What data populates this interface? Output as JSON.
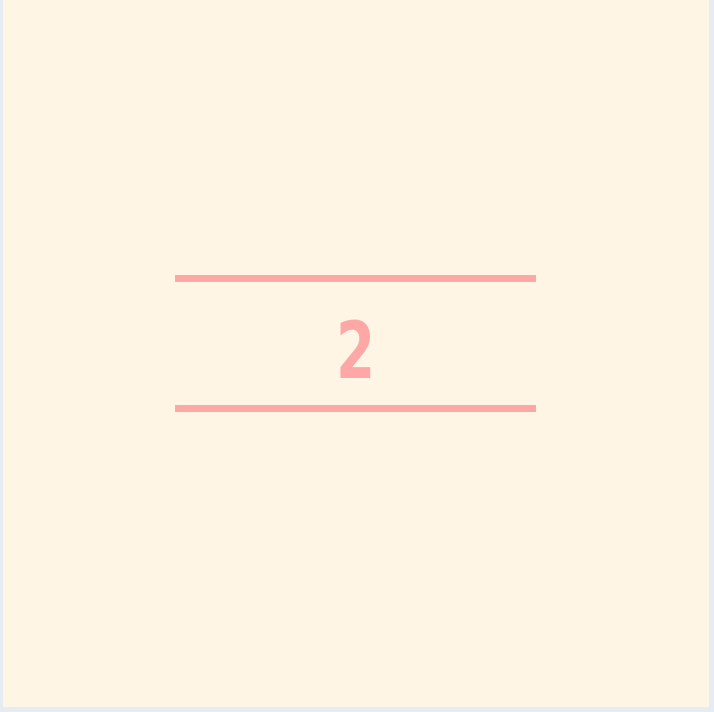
{
  "card": {
    "number": "2",
    "colors": {
      "background": "#fef5e4",
      "accent": "#fda8a7",
      "outer": "#e6ecf3"
    }
  }
}
